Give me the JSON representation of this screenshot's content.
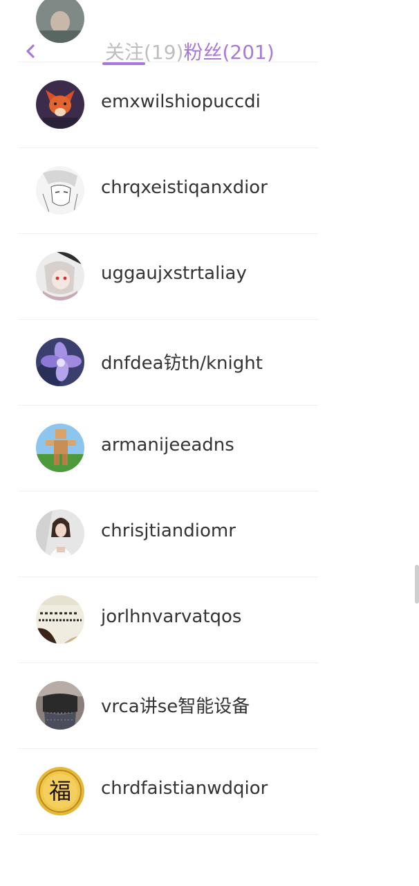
{
  "header": {
    "tabs": [
      {
        "label": "关注(19)",
        "active": false
      },
      {
        "label": "粉丝(201)",
        "active": true
      }
    ],
    "accent_color": "#a878d8",
    "inactive_color": "#bdbdbd"
  },
  "list": {
    "users": [
      {
        "name": "",
        "avatar_icon": "avatar-partial"
      },
      {
        "name": "emxwilshiopuccdi",
        "avatar_icon": "fox-avatar"
      },
      {
        "name": "chrqxeistiqanxdior",
        "avatar_icon": "manga-avatar"
      },
      {
        "name": "uggaujxstrtaliay",
        "avatar_icon": "anime-girl-avatar"
      },
      {
        "name": "dnfdea钫th/knight",
        "avatar_icon": "flower-avatar"
      },
      {
        "name": "armanijeeadns",
        "avatar_icon": "blocky-figure-avatar"
      },
      {
        "name": "chrisjtiandiomr",
        "avatar_icon": "woman-photo-avatar"
      },
      {
        "name": "jorlhnvarvatqos",
        "avatar_icon": "calligraphy-avatar"
      },
      {
        "name": "vrca讲se智能设备",
        "avatar_icon": "photo-avatar"
      },
      {
        "name": "chrdfaistianwdqior",
        "avatar_icon": "fu-character-avatar"
      }
    ]
  }
}
